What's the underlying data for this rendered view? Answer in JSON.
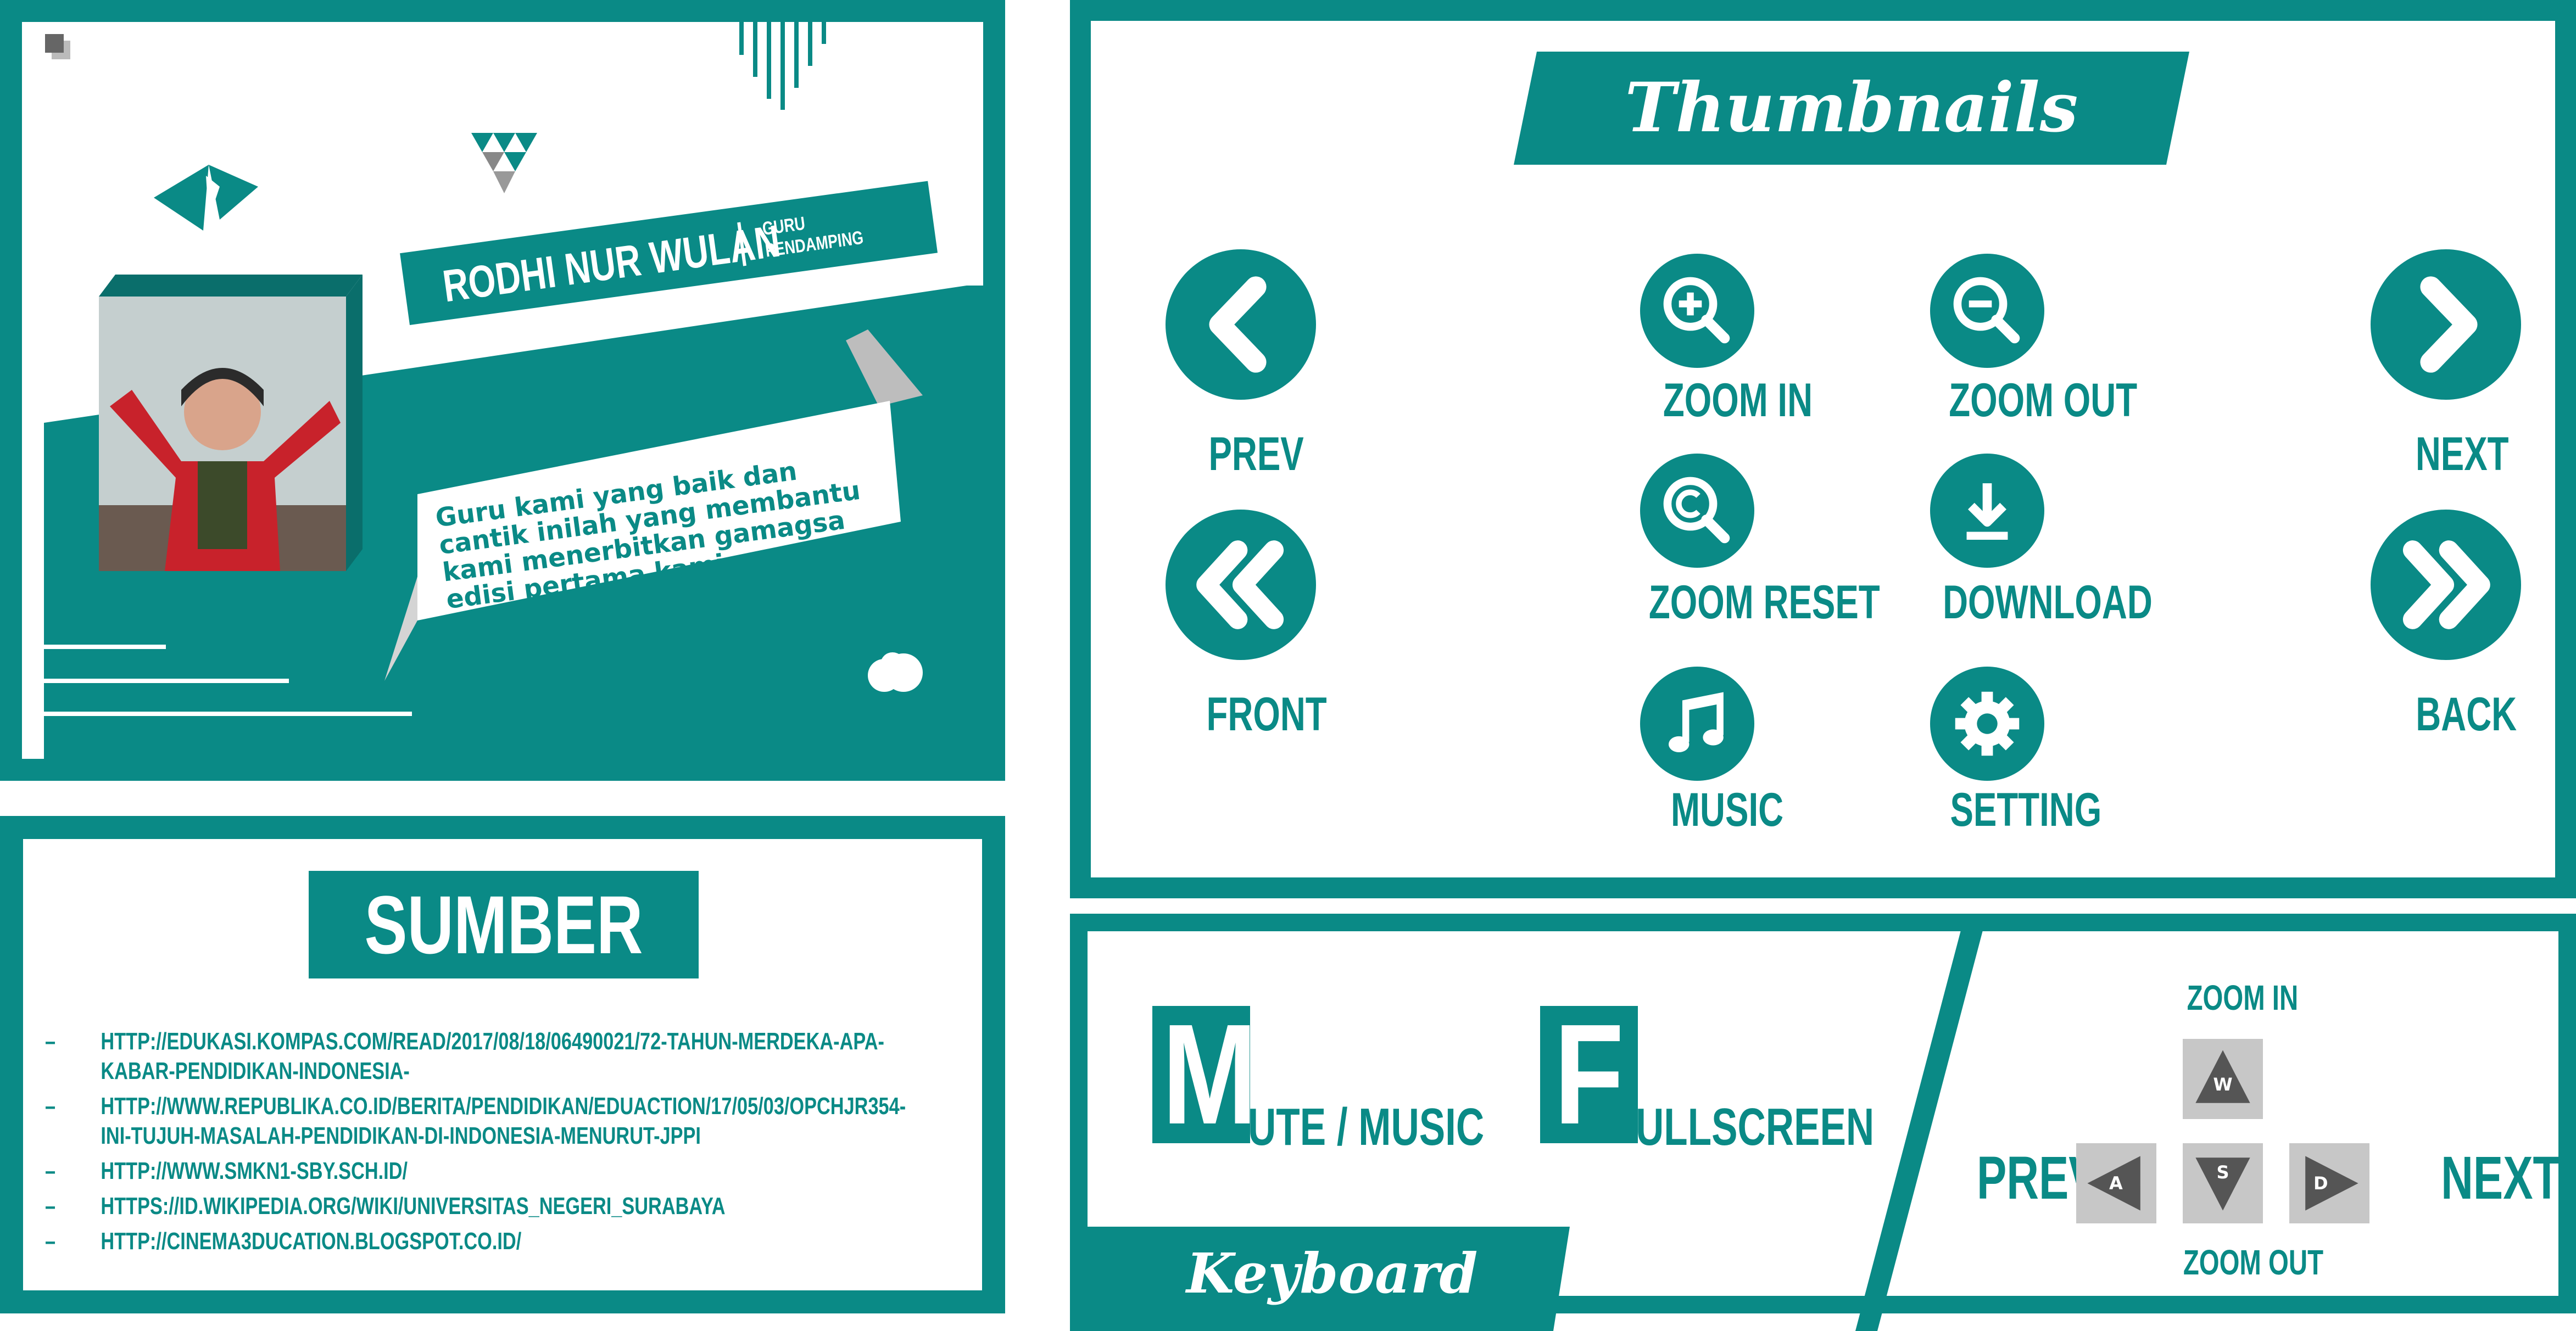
{
  "profile": {
    "name": "RODHI NUR WULAN",
    "role_line1": "GURU",
    "role_line2": "PENDAMPING",
    "message": "Guru kami yang baik dan cantik inilah yang membantu kami menerbitkan gamagsa edisi pertama kami.",
    "photo_icon": "person-photo"
  },
  "sources": {
    "title": "SUMBER",
    "items": [
      "HTTP://EDUKASI.KOMPAS.COM/READ/2017/08/18/06490021/72-TAHUN-MERDEKA-APA-KABAR-PENDIDIKAN-INDONESIA-",
      "HTTP://WWW.REPUBLIKA.CO.ID/BERITA/PENDIDIKAN/EDUACTION/17/05/03/OPCHJR354-INI-TUJUH-MASALAH-PENDIDIKAN-DI-INDONESIA-MENURUT-JPPI",
      "HTTP://WWW.SMKN1-SBY.SCH.ID/",
      "HTTPS://ID.WIKIPEDIA.ORG/WIKI/UNIVERSITAS_NEGERI_SURABAYA",
      "HTTP://CINEMA3DUCATION.BLOGSPOT.CO.ID/"
    ]
  },
  "thumbnails": {
    "title": "Thumbnails",
    "prev": "PREV",
    "front": "FRONT",
    "next": "NEXT",
    "back": "BACK",
    "zoom_in": "ZOOM IN",
    "zoom_out": "ZOOM OUT",
    "zoom_reset": "ZOOM RESET",
    "download": "DOWNLOAD",
    "music": "MUSIC",
    "setting": "SETTING"
  },
  "keyboard": {
    "title": "Keyboard",
    "mute_letter": "M",
    "mute_rest": "UTE / MUSIC",
    "full_letter": "F",
    "full_rest": "ULLSCREEN",
    "zoom_in": "ZOOM IN",
    "zoom_out": "ZOOM OUT",
    "prev": "PREV",
    "next": "NEXT",
    "key_w": "W",
    "key_a": "A",
    "key_s": "S",
    "key_d": "D"
  },
  "colors": {
    "accent": "#0a8a86",
    "key_bg": "#c7c7c7",
    "key_arrow": "#555555"
  }
}
